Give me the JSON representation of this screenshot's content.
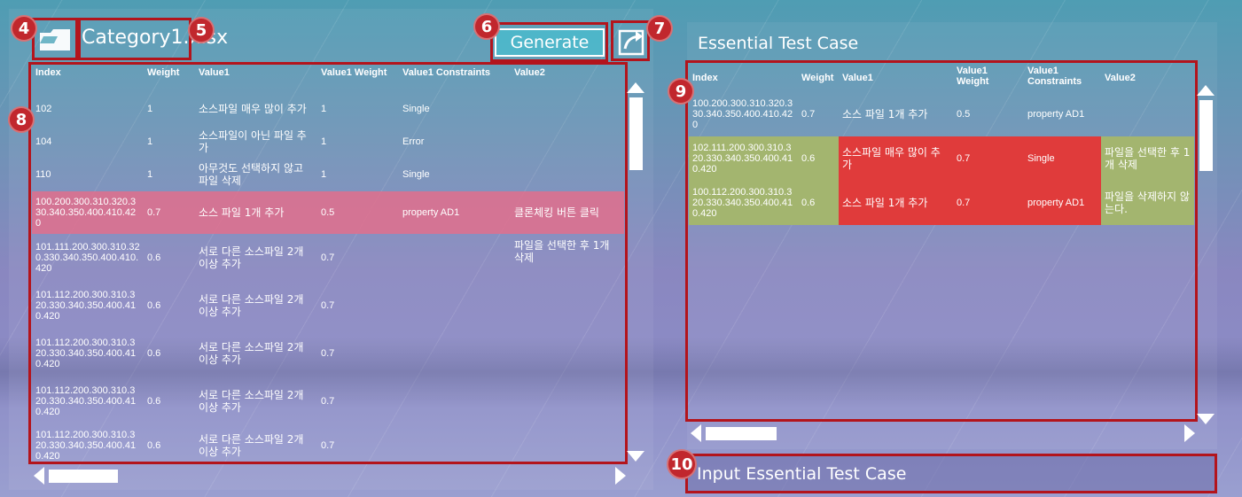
{
  "left": {
    "file_name": "Category1.xlsx",
    "generate_label": "Generate",
    "columns": [
      "Index",
      "Weight",
      "Value1",
      "Value1 Weight",
      "Value1 Constraints",
      "Value2"
    ],
    "rows": [
      {
        "index": "102",
        "weight": "1",
        "value1": "소스파일 매우 많이 추가",
        "v1weight": "1",
        "constraints": "Single",
        "value2": ""
      },
      {
        "index": "104",
        "weight": "1",
        "value1": "소스파일이 아닌 파일 추가",
        "v1weight": "1",
        "constraints": "Error",
        "value2": ""
      },
      {
        "index": "110",
        "weight": "1",
        "value1": "아무것도 선택하지 않고 파일 삭제",
        "v1weight": "1",
        "constraints": "Single",
        "value2": ""
      },
      {
        "index": "100.200.300.310.320.330.340.350.400.410.420",
        "weight": "0.7",
        "value1": "소스 파일 1개 추가",
        "v1weight": "0.5",
        "constraints": "property AD1",
        "value2": "클론체킹 버튼 클릭"
      },
      {
        "index": "101.111.200.300.310.320.330.340.350.400.410.420",
        "weight": "0.6",
        "value1": "서로 다른 소스파일 2개 이상 추가",
        "v1weight": "0.7",
        "constraints": "",
        "value2": "파일을 선택한 후 1개 삭제"
      },
      {
        "index": "101.112.200.300.310.320.330.340.350.400.410.420",
        "weight": "0.6",
        "value1": "서로 다른 소스파일 2개 이상 추가",
        "v1weight": "0.7",
        "constraints": "",
        "value2": ""
      },
      {
        "index": "101.112.200.300.310.320.330.340.350.400.410.420",
        "weight": "0.6",
        "value1": "서로 다른 소스파일 2개 이상 추가",
        "v1weight": "0.7",
        "constraints": "",
        "value2": ""
      },
      {
        "index": "101.112.200.300.310.320.330.340.350.400.410.420",
        "weight": "0.6",
        "value1": "서로 다른 소스파일 2개 이상 추가",
        "v1weight": "0.7",
        "constraints": "",
        "value2": ""
      },
      {
        "index": "101.112.200.300.310.320.330.340.350.400.410.420",
        "weight": "0.6",
        "value1": "서로 다른 소스파일 2개 이상 추가",
        "v1weight": "0.7",
        "constraints": "",
        "value2": ""
      }
    ]
  },
  "right": {
    "title": "Essential Test Case",
    "columns": [
      "Index",
      "Weight",
      "Value1",
      "Value1 Weight",
      "Value1 Constraints",
      "Value2"
    ],
    "rows": [
      {
        "index": "100.200.300.310.320.330.340.350.400.410.420",
        "weight": "0.7",
        "value1": "소스 파일 1개 추가",
        "v1weight": "0.5",
        "constraints": "property AD1",
        "value2": ""
      },
      {
        "index": "102.111.200.300.310.320.330.340.350.400.410.420",
        "weight": "0.6",
        "value1": "소스파일 매우 많이 추가",
        "v1weight": "0.7",
        "constraints": "Single",
        "value2": "파일을 선택한 후 1개 삭제"
      },
      {
        "index": "100.112.200.300.310.320.330.340.350.400.410.420",
        "weight": "0.6",
        "value1": "소스 파일 1개 추가",
        "v1weight": "0.7",
        "constraints": "property AD1",
        "value2": "파일을 삭제하지 않는다."
      }
    ],
    "input_label": "Input Essential Test Case"
  },
  "callouts": [
    "4",
    "5",
    "6",
    "7",
    "8",
    "9",
    "10"
  ],
  "colors": {
    "selected_row": "#e26e8c",
    "highlight_green": "#a3b56f",
    "highlight_red": "#e03b3b",
    "callout": "#c1272d",
    "callout_box": "#b3141c"
  }
}
